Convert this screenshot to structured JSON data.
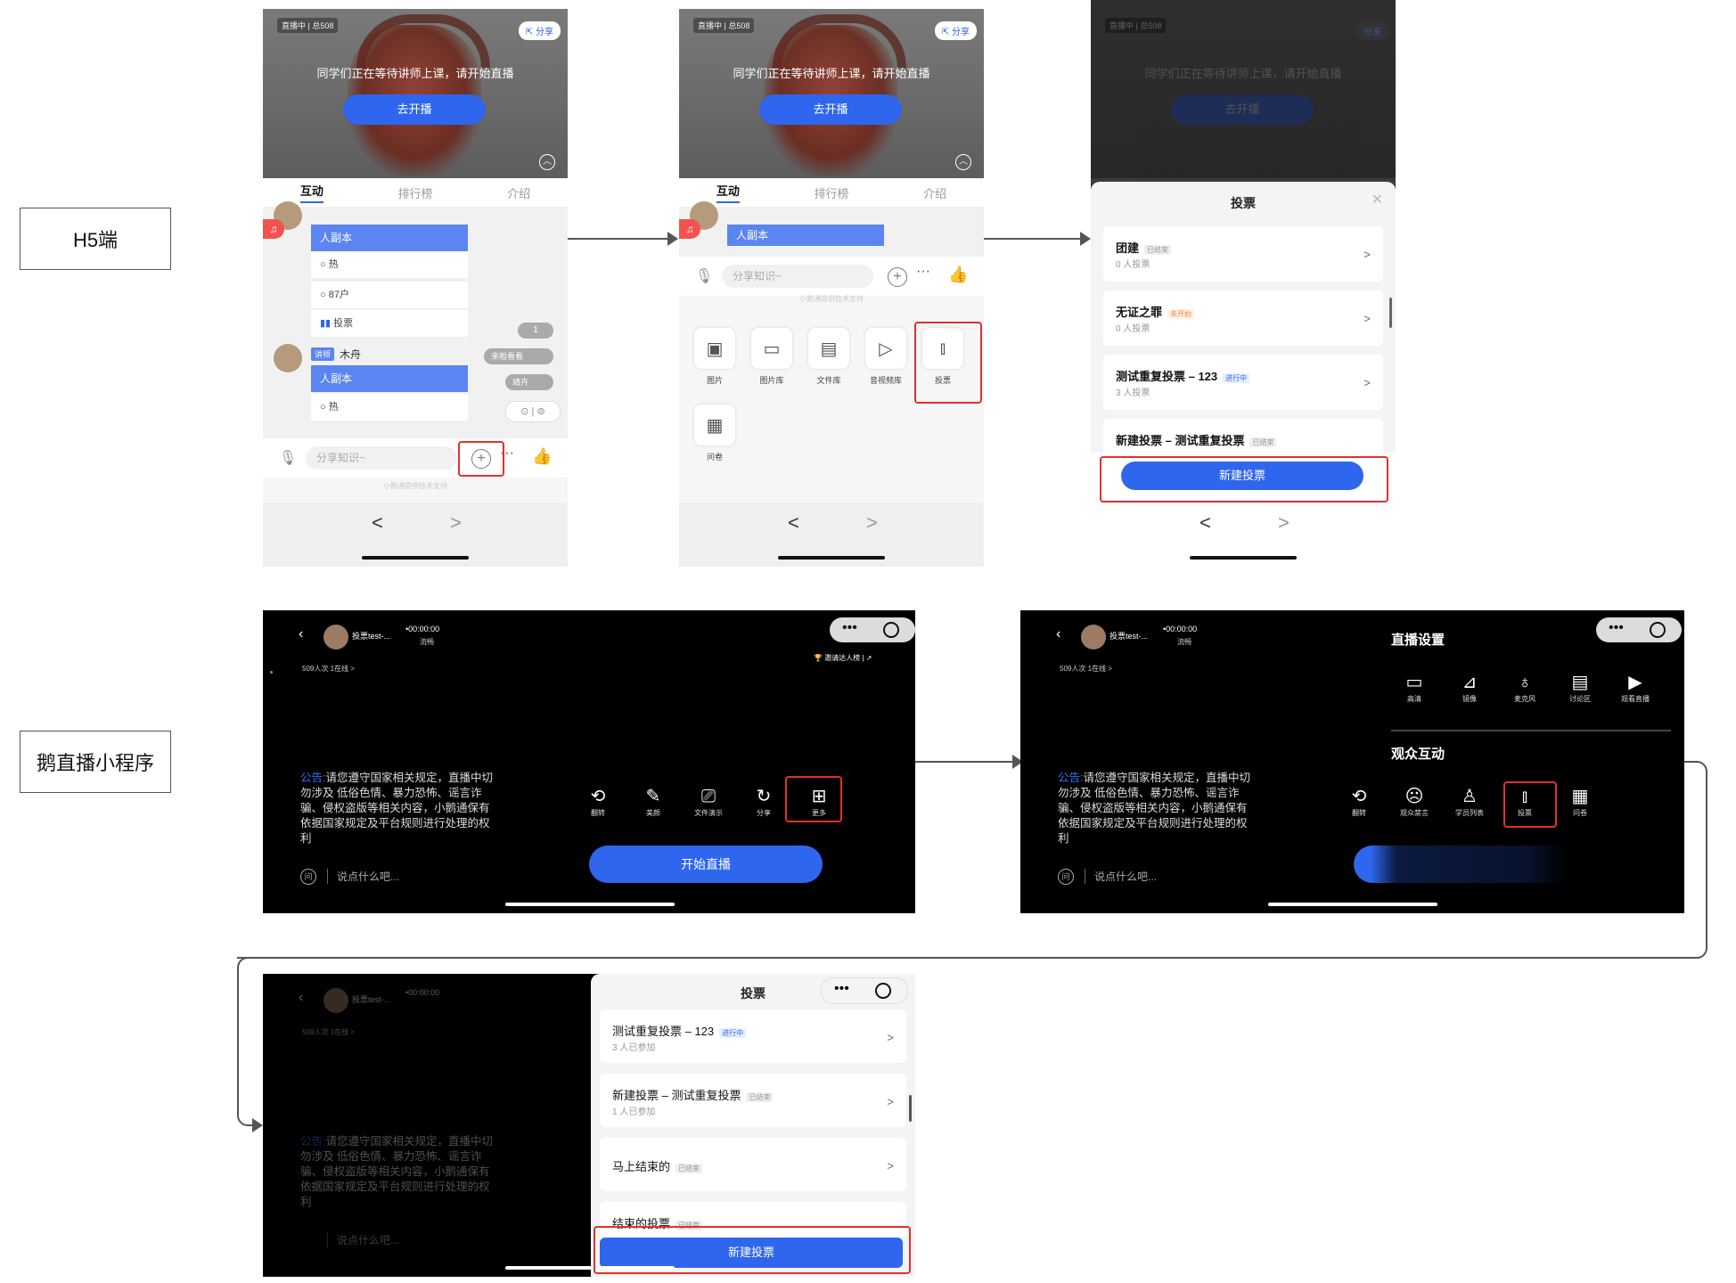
{
  "labels": {
    "h5": "H5端",
    "miniprogram": "鹅直播小程序"
  },
  "h5": {
    "live_tag": "直播中 | 总508",
    "share": "分享",
    "waiting_text": "同学们正在等待讲师上课，请开始直播",
    "start_button": "去开播",
    "tabs": [
      "互动",
      "排行榜",
      "介绍"
    ],
    "chat": {
      "teacher_name": "木舟",
      "teacher_tag": "讲师",
      "option_selected": "人副本",
      "options": [
        "热",
        "87户"
      ],
      "vote_label": "投票",
      "pill_count": "1",
      "pill_gift": "来啦看看",
      "pill_seat": "靖卉"
    },
    "input_placeholder": "分享知识~",
    "powered_by": "小鹅通提供技术支持",
    "tools": [
      "图片",
      "图片库",
      "文件库",
      "音视频库",
      "投票",
      "问卷"
    ],
    "nav_back": "<",
    "nav_forward": ">"
  },
  "h5_vote_panel": {
    "title": "投票",
    "items": [
      {
        "name": "团建",
        "badge": "已结束",
        "meta": "0 人投票"
      },
      {
        "name": "无证之罪",
        "badge": "未开始",
        "meta": "0 人投票"
      },
      {
        "name": "测试重复投票 – 123",
        "badge": "进行中",
        "meta": "3 人投票"
      },
      {
        "name": "新建投票 – 测试重复投票",
        "badge": "已结束",
        "meta": ""
      }
    ],
    "new_button": "新建投票"
  },
  "mini": {
    "host_name": "投票test-...",
    "timer": "•00:00:00",
    "quality": "流畅",
    "viewers": "509人次 1在线 >",
    "invite": "邀请达人榜",
    "notice_prefix": "公告:",
    "notice_body": "请您遵守国家相关规定，直播中切勿涉及 低俗色情、暴力恐怖、谣言诈骗、侵权盗版等相关内容，小鹅通保有依据国家规定及平台规则进行处理的权利",
    "say_placeholder": "说点什么吧...",
    "tools": [
      "翻转",
      "美颜",
      "文件演示",
      "分享",
      "更多"
    ],
    "start_button": "开始直播"
  },
  "mini_settings": {
    "title": "直播设置",
    "settings": [
      "高清",
      "镜像",
      "麦克风",
      "讨论区",
      "观看直播"
    ],
    "interaction_title": "观众互动",
    "interaction": [
      "翻转",
      "观众禁言",
      "学员列表",
      "投票",
      "问卷"
    ]
  },
  "mini_vote_panel": {
    "title": "投票",
    "items": [
      {
        "name": "测试重复投票 – 123",
        "badge": "进行中",
        "meta": "3 人已参加"
      },
      {
        "name": "新建投票 – 测试重复投票",
        "badge": "已结束",
        "meta": "1 人已参加"
      },
      {
        "name": "马上结束的",
        "badge": "已结束",
        "meta": ""
      },
      {
        "name": "结束的投票",
        "badge": "已结束",
        "meta": ""
      }
    ],
    "new_button": "新建投票"
  },
  "colors": {
    "accent": "#2f66ee",
    "highlight": "#e0312d",
    "dark_bg": "#000000"
  }
}
